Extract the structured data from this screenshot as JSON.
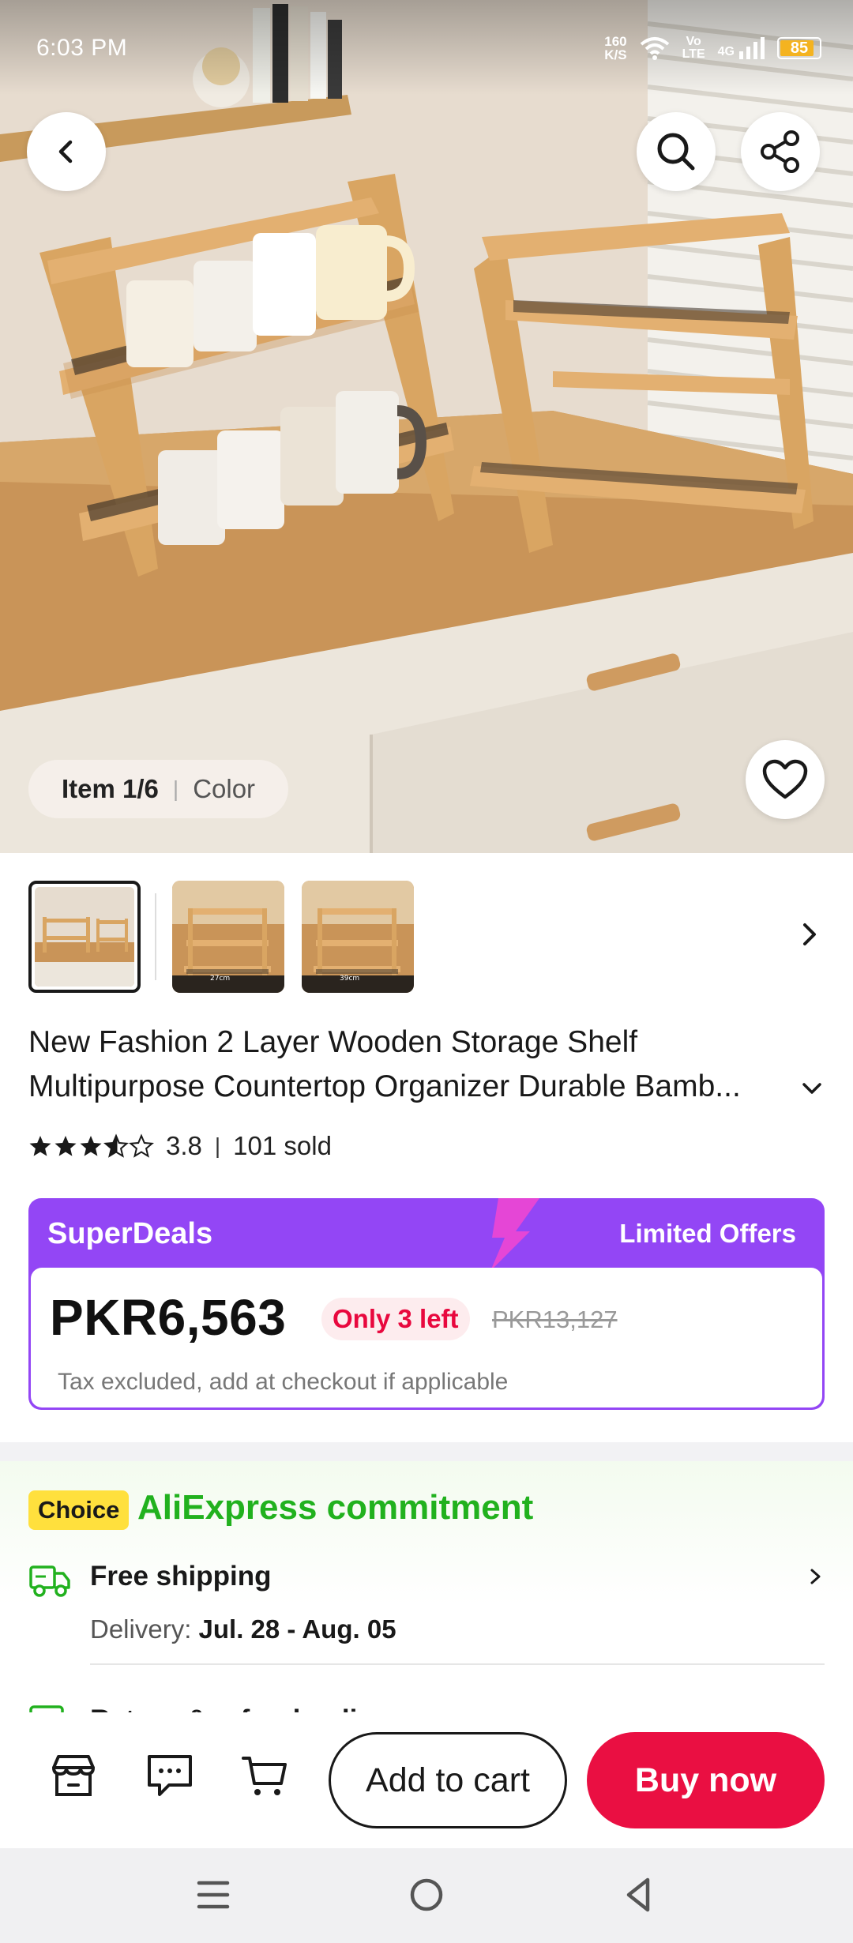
{
  "status_bar": {
    "time": "6:03 PM",
    "speed_value": "160",
    "speed_unit": "K/S",
    "volte_top": "Vo",
    "volte_bottom": "LTE",
    "network": "4G",
    "battery": "85"
  },
  "hero": {
    "item_counter": "Item 1/6",
    "selected_attribute": "Color",
    "icons": [
      "back-icon",
      "search-icon",
      "share-icon",
      "heart-icon"
    ]
  },
  "thumbnails": {
    "count_visible": 3,
    "dimension_labels": [
      "27cm",
      "39cm"
    ]
  },
  "product": {
    "title": "New Fashion 2 Layer Wooden Storage Shelf Multipurpose Countertop Organizer Durable Bamb...",
    "rating": "3.8",
    "rating_stars": 3.8,
    "sold": "101 sold"
  },
  "deals": {
    "title": "SuperDeals",
    "limited": "Limited Offers",
    "price": "PKR6,563",
    "stock_note": "Only 3 left",
    "original_price": "PKR13,127",
    "tax_note": "Tax excluded, add at checkout if applicable"
  },
  "commitment": {
    "badge": "Choice",
    "title": "AliExpress commitment",
    "shipping_label": "Free shipping",
    "delivery_prefix": "Delivery:",
    "delivery_dates": "Jul. 28 - Aug. 05",
    "next_row_partial": "Return & refund policy"
  },
  "actions": {
    "add_to_cart": "Add to cart",
    "buy_now": "Buy now"
  },
  "colors": {
    "accent_red": "#ea0f42",
    "deals_purple": "#9346f5",
    "choice_yellow": "#ffe03d",
    "commit_green": "#21b11e"
  }
}
